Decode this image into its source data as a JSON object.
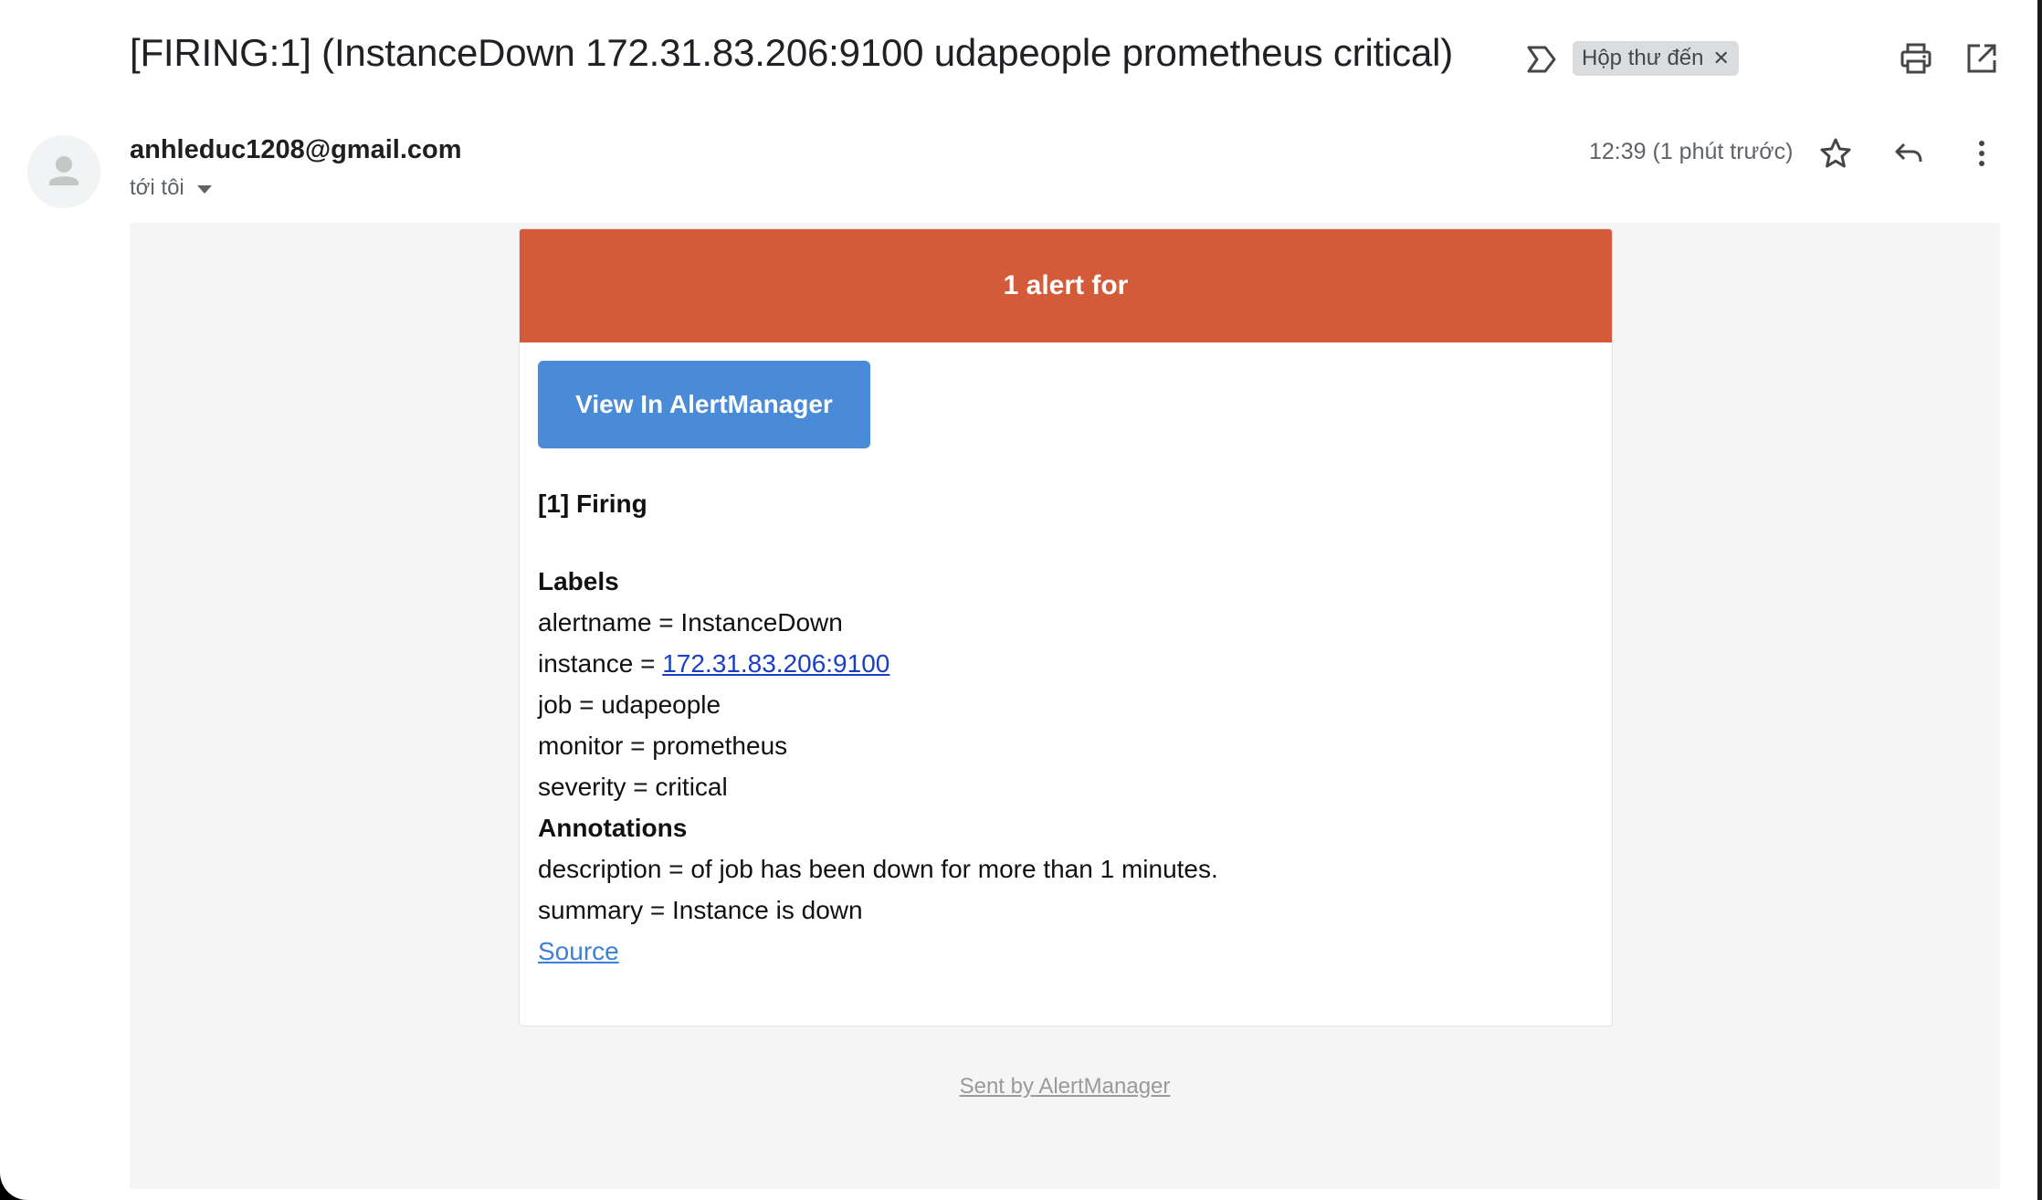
{
  "email": {
    "subject": "[FIRING:1] (InstanceDown 172.31.83.206:9100 udapeople prometheus critical)",
    "label_chip": "Hộp thư đến",
    "sender": "anhleduc1208@gmail.com",
    "recipient": "tới tôi",
    "time": "12:39 (1 phút trước)"
  },
  "alert": {
    "header": "1 alert for",
    "view_button": "View In AlertManager",
    "firing_title": "[1] Firing",
    "labels_title": "Labels",
    "alertname": "alertname = InstanceDown",
    "instance_prefix": "instance = ",
    "instance_value": "172.31.83.206:9100",
    "job": "job = udapeople",
    "monitor": "monitor = prometheus",
    "severity": "severity = critical",
    "annotations_title": "Annotations",
    "description": "description = of job has been down for more than 1 minutes.",
    "summary": "summary = Instance is down",
    "source_link": "Source",
    "footer": "Sent by AlertManager"
  },
  "colors": {
    "alert_header": "#d45b3a",
    "button": "#4a8bd8",
    "link": "#1a3fc4"
  },
  "icons": {
    "important": "important-marker-icon",
    "chip_close": "close-icon",
    "print": "print-icon",
    "new_window": "open-in-new-icon",
    "avatar": "person-icon",
    "star": "star-icon",
    "reply": "reply-icon",
    "more": "more-vert-icon"
  }
}
